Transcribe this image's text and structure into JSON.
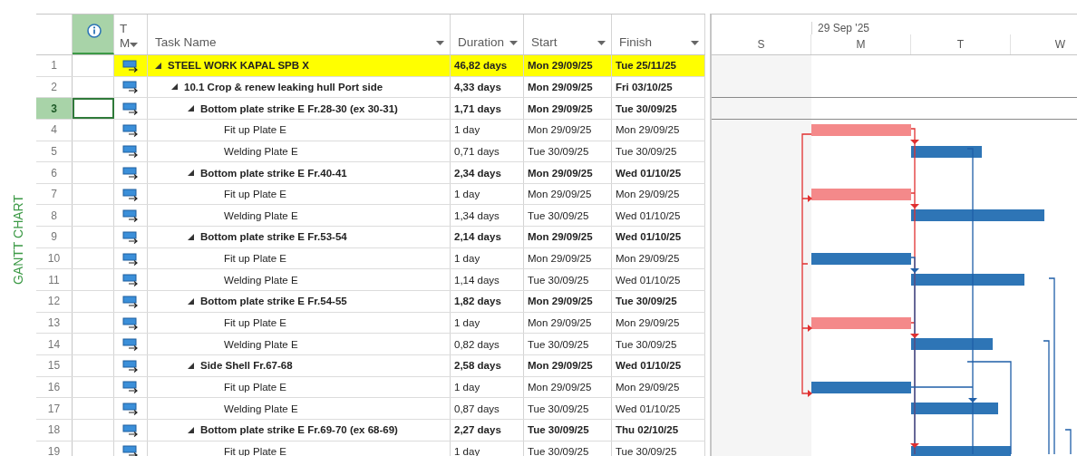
{
  "side_label": "GANTT CHART",
  "columns": [
    {
      "kind": "info",
      "selected": true
    },
    {
      "kind": "mode",
      "label": "T",
      "label_2": "M"
    },
    {
      "kind": "name",
      "label": "Task Name"
    },
    {
      "kind": "duration",
      "label": "Duration"
    },
    {
      "kind": "start",
      "label": "Start"
    },
    {
      "kind": "finish",
      "label": "Finish"
    }
  ],
  "timescale": {
    "week_label": "29 Sep '25",
    "days": [
      {
        "label": "S",
        "weekend": true
      },
      {
        "label": "M",
        "weekend": false
      },
      {
        "label": "T",
        "weekend": false
      },
      {
        "label": "W",
        "weekend": false
      }
    ]
  },
  "tasks": [
    {
      "num": "1",
      "name": "STEEL WORK KAPAL SPB X",
      "duration": "46,82 days",
      "start": "Mon 29/09/25",
      "finish": "Tue 25/11/25",
      "highlighted": true,
      "selected": false,
      "expanded": true,
      "children": [
        {
          "num": "2",
          "name": "10.1 Crop & renew leaking hull Port side",
          "duration": "4,33 days",
          "start": "Mon 29/09/25",
          "finish": "Fri 03/10/25",
          "highlighted": false,
          "selected": false,
          "expanded": true,
          "children": [
            {
              "num": "3",
              "name": "Bottom plate strike E Fr.28-30 (ex 30-31)",
              "duration": "1,71 days",
              "start": "Mon 29/09/25",
              "finish": "Tue 30/09/25",
              "highlighted": false,
              "selected": true,
              "expanded": true,
              "children": [
                {
                  "num": "4",
                  "name": "Fit up Plate E",
                  "duration": "1 day",
                  "start": "Mon 29/09/25",
                  "finish": "Mon 29/09/25",
                  "highlighted": false,
                  "selected": false,
                  "critical": true
                },
                {
                  "num": "5",
                  "name": "Welding Plate E",
                  "duration": "0,71 days",
                  "start": "Tue 30/09/25",
                  "finish": "Tue 30/09/25",
                  "highlighted": false,
                  "selected": false,
                  "critical": false
                }
              ]
            },
            {
              "num": "6",
              "name": "Bottom plate strike E Fr.40-41",
              "duration": "2,34 days",
              "start": "Mon 29/09/25",
              "finish": "Wed 01/10/25",
              "highlighted": false,
              "selected": false,
              "expanded": true,
              "children": [
                {
                  "num": "7",
                  "name": "Fit up Plate E",
                  "duration": "1 day",
                  "start": "Mon 29/09/25",
                  "finish": "Mon 29/09/25",
                  "highlighted": false,
                  "selected": false,
                  "critical": true
                },
                {
                  "num": "8",
                  "name": "Welding Plate E",
                  "duration": "1,34 days",
                  "start": "Tue 30/09/25",
                  "finish": "Wed 01/10/25",
                  "highlighted": false,
                  "selected": false,
                  "critical": false
                }
              ]
            },
            {
              "num": "9",
              "name": "Bottom plate strike E Fr.53-54",
              "duration": "2,14 days",
              "start": "Mon 29/09/25",
              "finish": "Wed 01/10/25",
              "highlighted": false,
              "selected": false,
              "expanded": true,
              "children": [
                {
                  "num": "10",
                  "name": "Fit up Plate E",
                  "duration": "1 day",
                  "start": "Mon 29/09/25",
                  "finish": "Mon 29/09/25",
                  "highlighted": false,
                  "selected": false,
                  "critical": false
                },
                {
                  "num": "11",
                  "name": "Welding Plate E",
                  "duration": "1,14 days",
                  "start": "Tue 30/09/25",
                  "finish": "Wed 01/10/25",
                  "highlighted": false,
                  "selected": false,
                  "critical": false
                }
              ]
            },
            {
              "num": "12",
              "name": "Bottom plate strike E Fr.54-55",
              "duration": "1,82 days",
              "start": "Mon 29/09/25",
              "finish": "Tue 30/09/25",
              "highlighted": false,
              "selected": false,
              "expanded": true,
              "children": [
                {
                  "num": "13",
                  "name": "Fit up Plate E",
                  "duration": "1 day",
                  "start": "Mon 29/09/25",
                  "finish": "Mon 29/09/25",
                  "highlighted": false,
                  "selected": false,
                  "critical": true
                },
                {
                  "num": "14",
                  "name": "Welding Plate E",
                  "duration": "0,82 days",
                  "start": "Tue 30/09/25",
                  "finish": "Tue 30/09/25",
                  "highlighted": false,
                  "selected": false,
                  "critical": false
                }
              ]
            },
            {
              "num": "15",
              "name": "Side Shell Fr.67-68",
              "duration": "2,58 days",
              "start": "Mon 29/09/25",
              "finish": "Wed 01/10/25",
              "highlighted": false,
              "selected": false,
              "expanded": true,
              "children": [
                {
                  "num": "16",
                  "name": "Fit up Plate E",
                  "duration": "1 day",
                  "start": "Mon 29/09/25",
                  "finish": "Mon 29/09/25",
                  "highlighted": false,
                  "selected": false,
                  "critical": false
                },
                {
                  "num": "17",
                  "name": "Welding Plate E",
                  "duration": "0,87 days",
                  "start": "Tue 30/09/25",
                  "finish": "Wed 01/10/25",
                  "highlighted": false,
                  "selected": false,
                  "critical": false
                }
              ]
            },
            {
              "num": "18",
              "name": "Bottom plate strike E Fr.69-70 (ex 68-69)",
              "duration": "2,27 days",
              "start": "Tue 30/09/25",
              "finish": "Thu 02/10/25",
              "highlighted": false,
              "selected": false,
              "expanded": true,
              "children": [
                {
                  "num": "19",
                  "name": "Fit up Plate E",
                  "duration": "1 day",
                  "start": "Tue 30/09/25",
                  "finish": "Tue 30/09/25",
                  "highlighted": false,
                  "selected": false,
                  "critical": false
                }
              ]
            }
          ]
        }
      ]
    }
  ]
}
